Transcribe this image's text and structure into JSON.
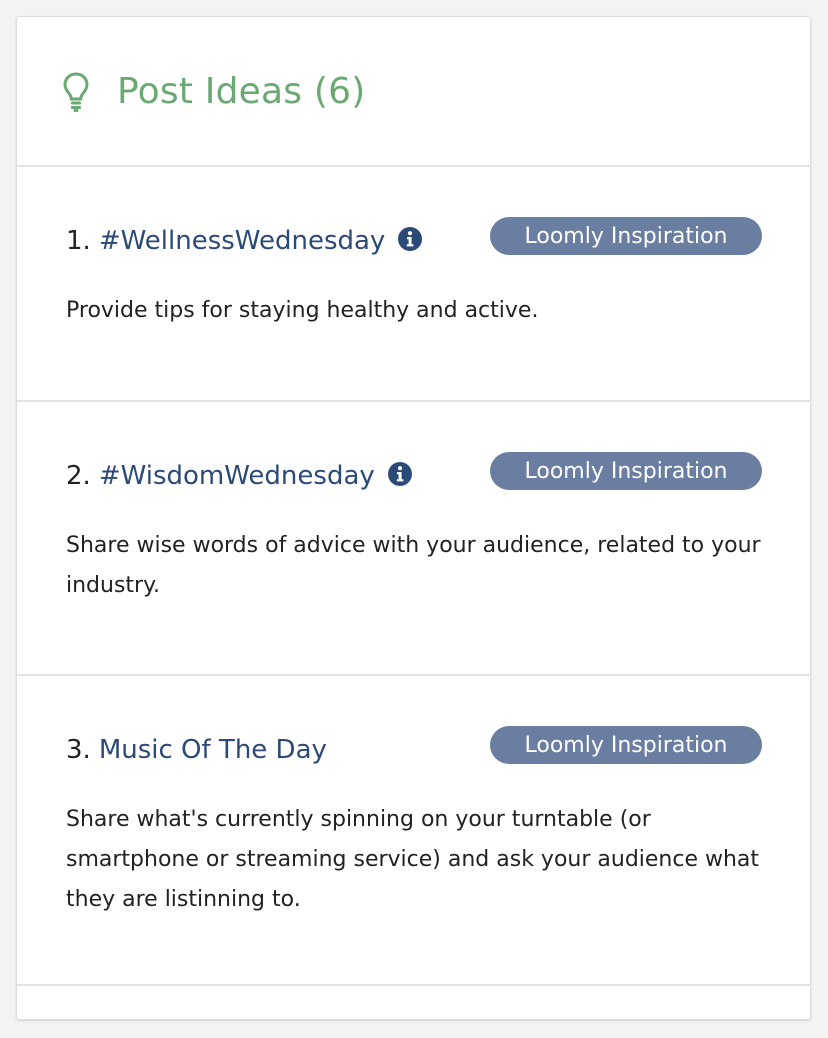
{
  "panel": {
    "title": "Post Ideas (6)",
    "icon": "lightbulb-icon",
    "accent_color": "#6aaa72"
  },
  "badge_color": "#6a7ea1",
  "ideas": [
    {
      "number": "1.",
      "name": "#WellnessWednesday",
      "has_info": true,
      "badge": "Loomly Inspiration",
      "description": "Provide tips for staying healthy and active."
    },
    {
      "number": "2.",
      "name": "#WisdomWednesday",
      "has_info": true,
      "badge": "Loomly Inspiration",
      "description": "Share wise words of advice with your audience, related to your industry."
    },
    {
      "number": "3.",
      "name": "Music Of The Day",
      "has_info": false,
      "badge": "Loomly Inspiration",
      "description": "Share what's currently spinning on your turntable (or smartphone or streaming service) and ask your audience what they are listinning to."
    }
  ]
}
